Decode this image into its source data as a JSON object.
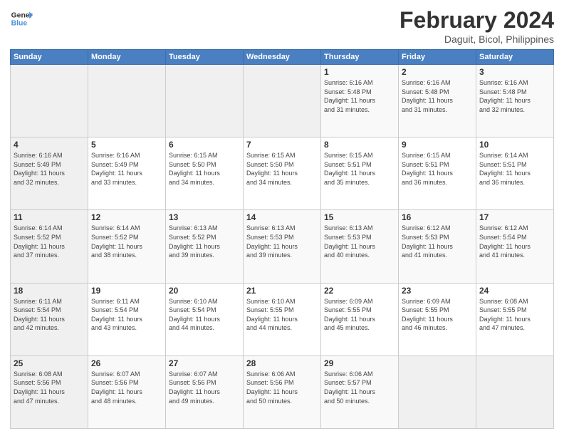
{
  "header": {
    "logo_line1": "General",
    "logo_line2": "Blue",
    "title": "February 2024",
    "subtitle": "Daguit, Bicol, Philippines"
  },
  "columns": [
    "Sunday",
    "Monday",
    "Tuesday",
    "Wednesday",
    "Thursday",
    "Friday",
    "Saturday"
  ],
  "weeks": [
    [
      {
        "day": "",
        "info": ""
      },
      {
        "day": "",
        "info": ""
      },
      {
        "day": "",
        "info": ""
      },
      {
        "day": "",
        "info": ""
      },
      {
        "day": "1",
        "info": "Sunrise: 6:16 AM\nSunset: 5:48 PM\nDaylight: 11 hours\nand 31 minutes."
      },
      {
        "day": "2",
        "info": "Sunrise: 6:16 AM\nSunset: 5:48 PM\nDaylight: 11 hours\nand 31 minutes."
      },
      {
        "day": "3",
        "info": "Sunrise: 6:16 AM\nSunset: 5:48 PM\nDaylight: 11 hours\nand 32 minutes."
      }
    ],
    [
      {
        "day": "4",
        "info": "Sunrise: 6:16 AM\nSunset: 5:49 PM\nDaylight: 11 hours\nand 32 minutes."
      },
      {
        "day": "5",
        "info": "Sunrise: 6:16 AM\nSunset: 5:49 PM\nDaylight: 11 hours\nand 33 minutes."
      },
      {
        "day": "6",
        "info": "Sunrise: 6:15 AM\nSunset: 5:50 PM\nDaylight: 11 hours\nand 34 minutes."
      },
      {
        "day": "7",
        "info": "Sunrise: 6:15 AM\nSunset: 5:50 PM\nDaylight: 11 hours\nand 34 minutes."
      },
      {
        "day": "8",
        "info": "Sunrise: 6:15 AM\nSunset: 5:51 PM\nDaylight: 11 hours\nand 35 minutes."
      },
      {
        "day": "9",
        "info": "Sunrise: 6:15 AM\nSunset: 5:51 PM\nDaylight: 11 hours\nand 36 minutes."
      },
      {
        "day": "10",
        "info": "Sunrise: 6:14 AM\nSunset: 5:51 PM\nDaylight: 11 hours\nand 36 minutes."
      }
    ],
    [
      {
        "day": "11",
        "info": "Sunrise: 6:14 AM\nSunset: 5:52 PM\nDaylight: 11 hours\nand 37 minutes."
      },
      {
        "day": "12",
        "info": "Sunrise: 6:14 AM\nSunset: 5:52 PM\nDaylight: 11 hours\nand 38 minutes."
      },
      {
        "day": "13",
        "info": "Sunrise: 6:13 AM\nSunset: 5:52 PM\nDaylight: 11 hours\nand 39 minutes."
      },
      {
        "day": "14",
        "info": "Sunrise: 6:13 AM\nSunset: 5:53 PM\nDaylight: 11 hours\nand 39 minutes."
      },
      {
        "day": "15",
        "info": "Sunrise: 6:13 AM\nSunset: 5:53 PM\nDaylight: 11 hours\nand 40 minutes."
      },
      {
        "day": "16",
        "info": "Sunrise: 6:12 AM\nSunset: 5:53 PM\nDaylight: 11 hours\nand 41 minutes."
      },
      {
        "day": "17",
        "info": "Sunrise: 6:12 AM\nSunset: 5:54 PM\nDaylight: 11 hours\nand 41 minutes."
      }
    ],
    [
      {
        "day": "18",
        "info": "Sunrise: 6:11 AM\nSunset: 5:54 PM\nDaylight: 11 hours\nand 42 minutes."
      },
      {
        "day": "19",
        "info": "Sunrise: 6:11 AM\nSunset: 5:54 PM\nDaylight: 11 hours\nand 43 minutes."
      },
      {
        "day": "20",
        "info": "Sunrise: 6:10 AM\nSunset: 5:54 PM\nDaylight: 11 hours\nand 44 minutes."
      },
      {
        "day": "21",
        "info": "Sunrise: 6:10 AM\nSunset: 5:55 PM\nDaylight: 11 hours\nand 44 minutes."
      },
      {
        "day": "22",
        "info": "Sunrise: 6:09 AM\nSunset: 5:55 PM\nDaylight: 11 hours\nand 45 minutes."
      },
      {
        "day": "23",
        "info": "Sunrise: 6:09 AM\nSunset: 5:55 PM\nDaylight: 11 hours\nand 46 minutes."
      },
      {
        "day": "24",
        "info": "Sunrise: 6:08 AM\nSunset: 5:55 PM\nDaylight: 11 hours\nand 47 minutes."
      }
    ],
    [
      {
        "day": "25",
        "info": "Sunrise: 6:08 AM\nSunset: 5:56 PM\nDaylight: 11 hours\nand 47 minutes."
      },
      {
        "day": "26",
        "info": "Sunrise: 6:07 AM\nSunset: 5:56 PM\nDaylight: 11 hours\nand 48 minutes."
      },
      {
        "day": "27",
        "info": "Sunrise: 6:07 AM\nSunset: 5:56 PM\nDaylight: 11 hours\nand 49 minutes."
      },
      {
        "day": "28",
        "info": "Sunrise: 6:06 AM\nSunset: 5:56 PM\nDaylight: 11 hours\nand 50 minutes."
      },
      {
        "day": "29",
        "info": "Sunrise: 6:06 AM\nSunset: 5:57 PM\nDaylight: 11 hours\nand 50 minutes."
      },
      {
        "day": "",
        "info": ""
      },
      {
        "day": "",
        "info": ""
      }
    ]
  ]
}
